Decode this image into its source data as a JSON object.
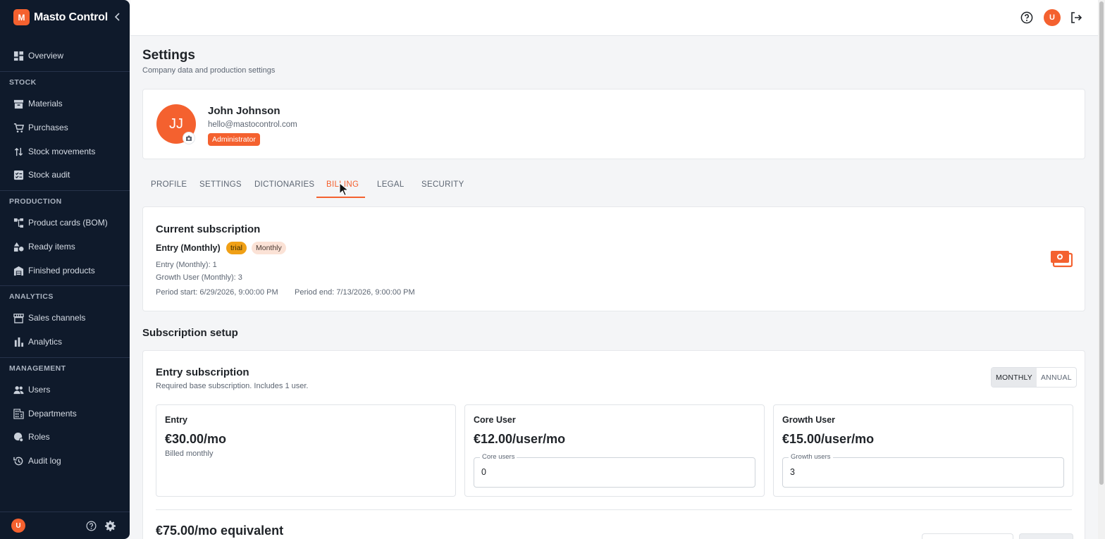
{
  "app": {
    "logo_letter": "M",
    "name": "Masto Control"
  },
  "sidebar": {
    "overview": "Overview",
    "sections": {
      "stock": "STOCK",
      "production": "PRODUCTION",
      "analytics": "ANALYTICS",
      "management": "MANAGEMENT"
    },
    "items": {
      "materials": "Materials",
      "purchases": "Purchases",
      "stock_movements": "Stock movements",
      "stock_audit": "Stock audit",
      "product_cards": "Product cards (BOM)",
      "ready_items": "Ready items",
      "finished_products": "Finished products",
      "sales_channels": "Sales channels",
      "analytics": "Analytics",
      "users": "Users",
      "departments": "Departments",
      "roles": "Roles",
      "audit_log": "Audit log"
    },
    "user_initial": "U"
  },
  "topbar": {
    "user_initial": "U"
  },
  "page": {
    "title": "Settings",
    "subtitle": "Company data and production settings"
  },
  "profile": {
    "initials": "JJ",
    "name": "John Johnson",
    "email": "hello@mastocontrol.com",
    "role": "Administrator"
  },
  "tabs": [
    "PROFILE",
    "SETTINGS",
    "DICTIONARIES",
    "BILLING",
    "LEGAL",
    "SECURITY"
  ],
  "active_tab": "BILLING",
  "current_subscription": {
    "heading": "Current subscription",
    "plan": "Entry (Monthly)",
    "status_chip": "trial",
    "period_chip": "Monthly",
    "line1": "Entry (Monthly): 1",
    "line2": "Growth User (Monthly): 3",
    "period_start": "Period start: 6/29/2026, 9:00:00 PM",
    "period_end": "Period end: 7/13/2026, 9:00:00 PM"
  },
  "setup": {
    "heading": "Subscription setup",
    "entry_heading": "Entry subscription",
    "entry_desc": "Required base subscription. Includes 1 user.",
    "billing_toggle": {
      "monthly": "MONTHLY",
      "annual": "ANNUAL",
      "selected": "MONTHLY"
    },
    "plans": {
      "entry": {
        "title": "Entry",
        "price": "€30.00/mo",
        "note": "Billed monthly"
      },
      "core": {
        "title": "Core User",
        "price": "€12.00/user/mo",
        "field_label": "Core users",
        "value": "0"
      },
      "growth": {
        "title": "Growth User",
        "price": "€15.00/user/mo",
        "field_label": "Growth users",
        "value": "3"
      }
    },
    "total": "€75.00/mo equivalent"
  },
  "colors": {
    "accent": "#f4612f",
    "sidebar_bg": "#0f1a2b",
    "trial": "#f0a016"
  },
  "icons": [
    "collapse-chevron-icon",
    "help-icon",
    "logout-icon",
    "camera-icon",
    "money-icon",
    "settings-gear-icon"
  ]
}
